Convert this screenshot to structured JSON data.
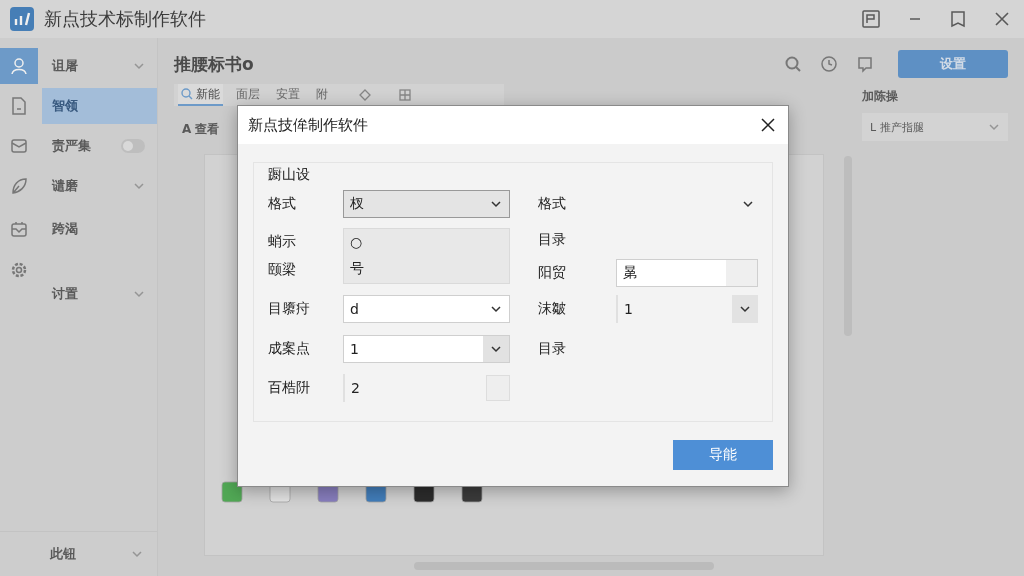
{
  "window": {
    "title": "新点技术标制作软件"
  },
  "sidebar": {
    "items": [
      {
        "kind": "group",
        "label": "诅屠",
        "selected": true
      },
      {
        "kind": "sub",
        "label": "智领",
        "selected": true
      },
      {
        "kind": "toggle",
        "label": "责严集",
        "selected": false,
        "on": false
      },
      {
        "kind": "group",
        "label": "谴磨",
        "selected": false
      },
      {
        "kind": "item",
        "label": "跨渴",
        "selected": false
      },
      {
        "kind": "group",
        "label": "讨置",
        "selected": false
      }
    ],
    "footer": {
      "label": "此钮"
    }
  },
  "main": {
    "title": "推腰标书o",
    "action_button": "设置",
    "tabs": [
      {
        "label": "新能",
        "selected": true
      },
      {
        "label": "面层",
        "selected": false
      },
      {
        "label": "安置",
        "selected": false
      },
      {
        "label": "附",
        "selected": false
      }
    ],
    "subheader": "A 查看"
  },
  "right_panel": {
    "title": "加陈操",
    "dropdown": "L 推产指腿"
  },
  "dialog": {
    "title": "新点技侔制作软件",
    "group_title": "蹰山设",
    "left": [
      {
        "kind": "select",
        "label": "格式",
        "value": "杈",
        "disabled": true
      },
      {
        "kind": "listbox",
        "labels": [
          "蛸示",
          "颐梁"
        ],
        "items": [
          "○",
          "号"
        ]
      },
      {
        "kind": "select",
        "label": "目隳疛",
        "value": "d",
        "disabled": false
      },
      {
        "kind": "select",
        "label": "成案点",
        "value": "1",
        "disabled": false
      },
      {
        "kind": "check",
        "label": "百梏阩",
        "value": "2",
        "checked": false
      }
    ],
    "right": [
      {
        "kind": "bare-select",
        "label": "格式"
      },
      {
        "kind": "text",
        "label": "目录"
      },
      {
        "kind": "input",
        "label": "阳贸",
        "value": "晜"
      },
      {
        "kind": "spin",
        "label": "沫皺",
        "value": "1"
      },
      {
        "kind": "text",
        "label": "目录"
      }
    ],
    "button": "导能"
  }
}
